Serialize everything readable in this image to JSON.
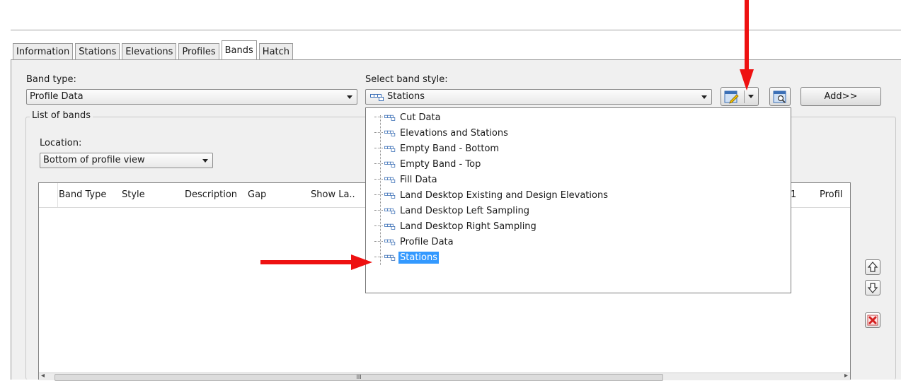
{
  "tabs": [
    {
      "label": "Information"
    },
    {
      "label": "Stations"
    },
    {
      "label": "Elevations"
    },
    {
      "label": "Profiles"
    },
    {
      "label": "Bands",
      "active": true
    },
    {
      "label": "Hatch"
    }
  ],
  "band_type": {
    "label": "Band type:",
    "value": "Profile Data"
  },
  "band_style": {
    "label": "Select band style:",
    "value": "Stations"
  },
  "add_button": {
    "label": "Add>>"
  },
  "list_of_bands": {
    "title": "List of bands",
    "location_label": "Location:",
    "location_value": "Bottom of profile view"
  },
  "grid": {
    "columns": [
      "Band Type",
      "Style",
      "Description",
      "Gap",
      "Show La..",
      "1",
      "Profil"
    ]
  },
  "style_options": [
    {
      "label": "Cut Data"
    },
    {
      "label": "Elevations and Stations"
    },
    {
      "label": "Empty Band - Bottom"
    },
    {
      "label": "Empty Band - Top"
    },
    {
      "label": "Fill Data"
    },
    {
      "label": "Land Desktop Existing and Design Elevations"
    },
    {
      "label": "Land Desktop Left Sampling"
    },
    {
      "label": "Land Desktop Right Sampling"
    },
    {
      "label": "Profile Data"
    },
    {
      "label": "Stations",
      "selected": true
    }
  ],
  "scrollbar": {
    "thumb_glyph": "III"
  },
  "icons": {
    "band_style_icon": "band-style-icon",
    "edit_style": "edit-style-icon",
    "preview": "preview-icon",
    "move_up": "arrow-up-icon",
    "move_down": "arrow-down-icon",
    "delete": "delete-icon"
  },
  "colors": {
    "selection": "#3399ff",
    "annotation_arrow": "#ee1111",
    "delete_icon": "#d42020"
  }
}
